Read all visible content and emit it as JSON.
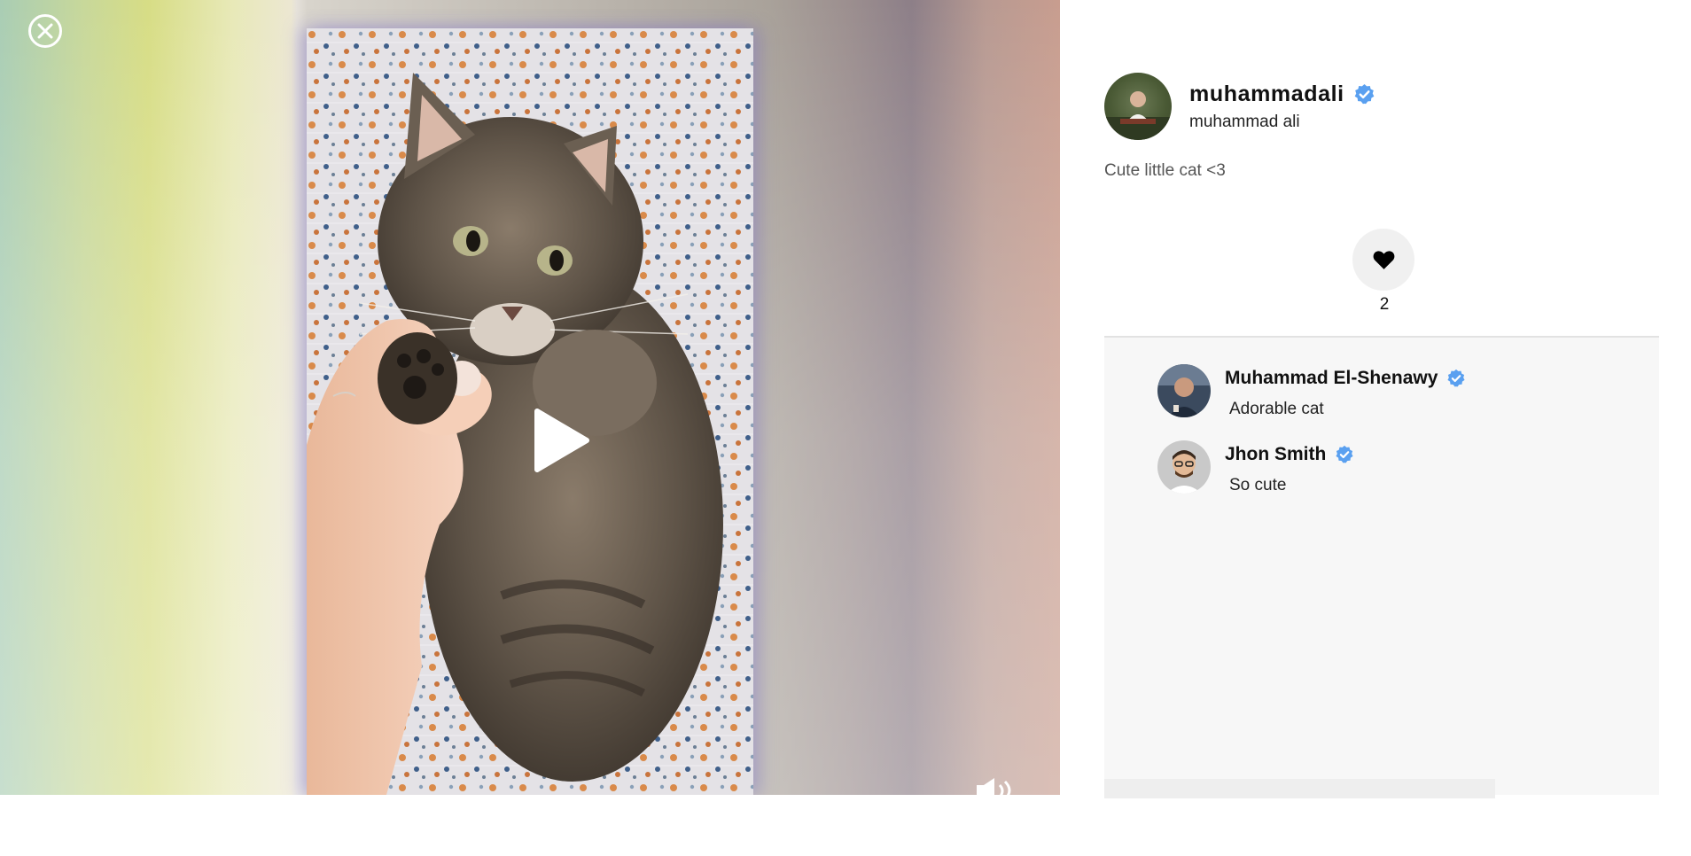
{
  "viewer": {
    "close_icon": "close-circle-icon",
    "play_icon": "play-icon",
    "volume_icon": "volume-icon",
    "colors": {
      "frame_glow": "#8877d6",
      "icon": "#ffffff"
    }
  },
  "post": {
    "author": {
      "username": "muhammadali",
      "full_name": "muhammad ali",
      "verified": true
    },
    "caption": "Cute little cat <3",
    "likes": {
      "icon": "heart-icon",
      "count": "2"
    },
    "comments": [
      {
        "author": "Muhammad El-Shenawy",
        "verified": true,
        "text": "Adorable cat"
      },
      {
        "author": "Jhon Smith",
        "verified": true,
        "text": "So cute"
      }
    ]
  },
  "colors": {
    "verified_badge": "#5aa0f0",
    "like_button_bg": "#f0f0f0",
    "comments_bg": "#f7f7f7"
  }
}
